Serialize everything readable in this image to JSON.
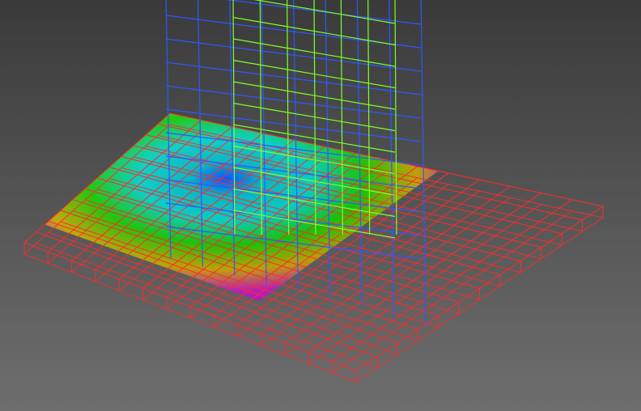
{
  "viewport": {
    "background_top": "#3a3a3a",
    "background_bottom": "#6e6e6e"
  },
  "colors": {
    "red_mesh": "#ff2a2a",
    "blue_mesh": "#2f58ff",
    "green_mesh": "#7dff2a",
    "colormap": [
      "#b000e0",
      "#c6a600",
      "#16c800",
      "#00b8c8",
      "#0050ff"
    ]
  },
  "scene": {
    "red_mesh_divisions": [
      14,
      12
    ],
    "blue_mesh_divisions": [
      8,
      10
    ],
    "green_mesh_divisions": [
      6,
      10
    ]
  }
}
